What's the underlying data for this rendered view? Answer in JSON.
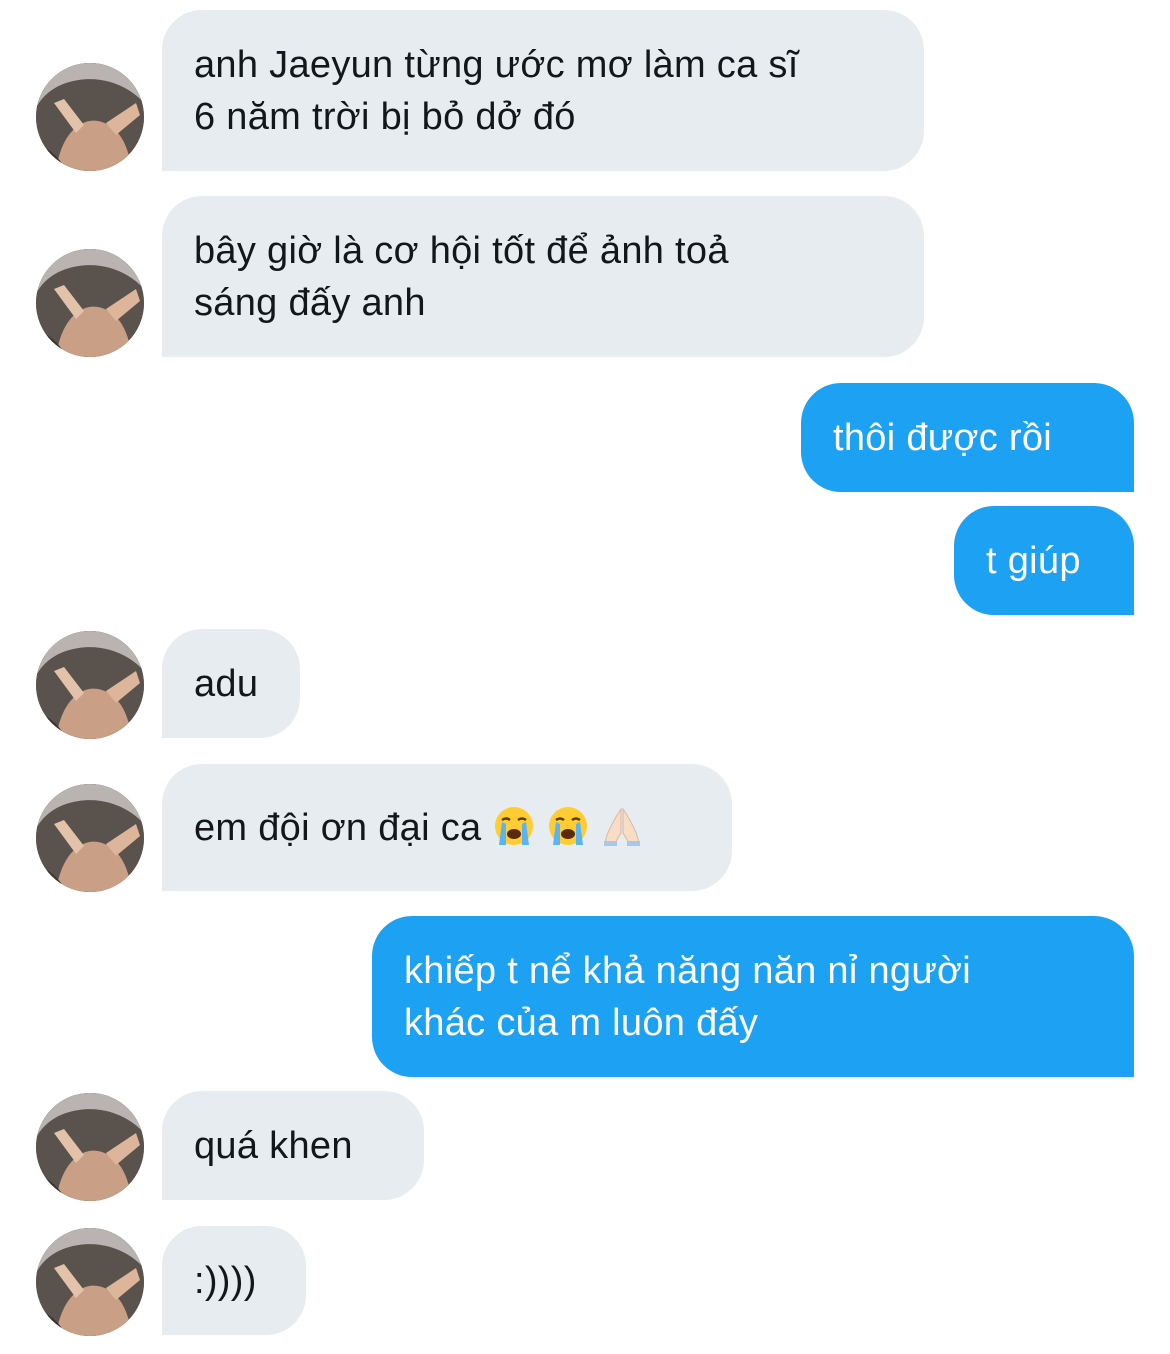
{
  "conversation": {
    "messages": [
      {
        "sender": "other",
        "lines": [
          "anh Jaeyun từng ước mơ làm ca sĩ",
          "6 năm trời bị bỏ dở đó"
        ]
      },
      {
        "sender": "other",
        "lines": [
          "bây giờ là cơ hội tốt để ảnh toả",
          "sáng đấy anh"
        ]
      },
      {
        "sender": "me",
        "lines": [
          "thôi được rồi"
        ]
      },
      {
        "sender": "me",
        "lines": [
          "t giúp"
        ]
      },
      {
        "sender": "other",
        "lines": [
          "adu"
        ]
      },
      {
        "sender": "other",
        "lines": [
          "em đội ơn đại ca"
        ],
        "emoji": [
          "loudly-crying-face-icon",
          "loudly-crying-face-icon",
          "folded-hands-icon"
        ]
      },
      {
        "sender": "me",
        "lines": [
          "khiếp t nể khả năng năn nỉ người",
          "khác của m luôn đấy"
        ]
      },
      {
        "sender": "other",
        "lines": [
          "quá khen"
        ]
      },
      {
        "sender": "other",
        "lines": [
          ":))))"
        ]
      }
    ]
  },
  "colors": {
    "incoming_bubble": "#e6ecf0",
    "incoming_text": "#14171a",
    "outgoing_bubble": "#1da1f2",
    "outgoing_text": "#ffffff"
  }
}
